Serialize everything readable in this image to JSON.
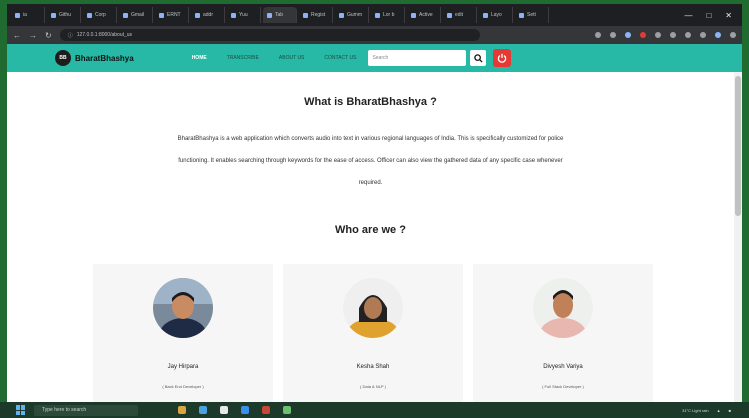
{
  "browser": {
    "tabs": [
      "ia",
      "Githu",
      "Corp",
      "Gmail",
      "ERNT",
      "addr",
      "Yuu",
      "Tab",
      "Regist",
      "Gumm",
      "Lor b",
      "Active",
      "edit",
      "Layo",
      "Sett"
    ],
    "url": "127.0.0.1:8000/about_us"
  },
  "nav": {
    "brand": "BharatBhashya",
    "links": [
      "HOME",
      "TRANSCRIBE",
      "ABOUT US",
      "CONTACT US"
    ],
    "search_placeholder": "Search"
  },
  "content": {
    "what_heading": "What is BharatBhashya ?",
    "description_lines": [
      "BharatBhashya is a web application which converts audio into text in various regional languages of India. This is specifically customized for police",
      "functioning. It enables searching through keywords for the ease of access. Officer can also view the gathered data of any specific case whenever",
      "required."
    ],
    "who_heading": "Who are we ?",
    "team": [
      {
        "name": "Jay Hirpara",
        "role": "( Back End Developer )"
      },
      {
        "name": "Kesha Shah",
        "role": "( Data & NLP )"
      },
      {
        "name": "Divyesh Variya",
        "role": "( Full Stack Developer )"
      }
    ]
  },
  "taskbar": {
    "search_placeholder": "Type here to search",
    "weather": "31°C Light rain"
  },
  "colors": {
    "nav_bg": "#27b9a5",
    "power_button": "#e53935",
    "page_bg": "#ffffff",
    "card_bg": "#f6f6f6",
    "desktop_bg": "#1f6b30"
  },
  "icons": [
    "search-icon",
    "power-icon",
    "windows-start-icon",
    "chrome-icon",
    "vscode-icon"
  ]
}
